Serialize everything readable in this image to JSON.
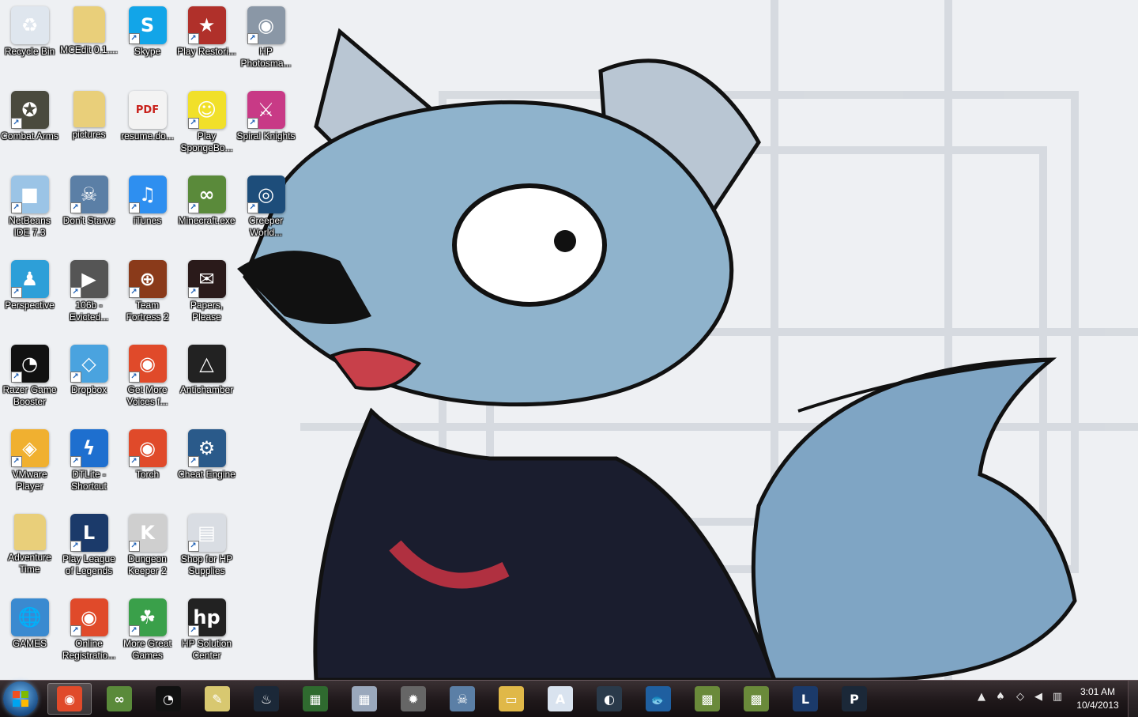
{
  "desktop": {
    "icons": [
      {
        "label": "Recycle Bin",
        "icon": "recycle-bin-icon",
        "bg": "#dfe6ee",
        "glyph": "♻",
        "shortcut": false
      },
      {
        "label": "MCEdit 0.1....",
        "icon": "folder-icon",
        "bg": "#e9cf7a",
        "glyph": "",
        "shortcut": false
      },
      {
        "label": "Skype",
        "icon": "skype-icon",
        "bg": "#12a5e8",
        "glyph": "S",
        "shortcut": true
      },
      {
        "label": "Play Restori...",
        "icon": "game-icon",
        "bg": "#b0302a",
        "glyph": "★",
        "shortcut": true
      },
      {
        "label": "HP Photosma...",
        "icon": "camera-icon",
        "bg": "#8a97a6",
        "glyph": "◉",
        "shortcut": true
      },
      {
        "label": "Combat Arms",
        "icon": "soldier-icon",
        "bg": "#4a4a3e",
        "glyph": "✪",
        "shortcut": true
      },
      {
        "label": "pictures",
        "icon": "folder-icon",
        "bg": "#e9cf7a",
        "glyph": "",
        "shortcut": false
      },
      {
        "label": "resume.do...",
        "icon": "pdf-icon",
        "bg": "#f3f3f3",
        "glyph": "PDF",
        "shortcut": false
      },
      {
        "label": "Play SpongeBo...",
        "icon": "spongebob-icon",
        "bg": "#f1e02a",
        "glyph": "☺",
        "shortcut": true
      },
      {
        "label": "Spiral Knights",
        "icon": "spiral-knights-icon",
        "bg": "#c83a86",
        "glyph": "⚔",
        "shortcut": true
      },
      {
        "label": "NetBeans IDE 7.3",
        "icon": "netbeans-cube-icon",
        "bg": "#9bc4e6",
        "glyph": "■",
        "shortcut": true
      },
      {
        "label": "Don't Starve",
        "icon": "dont-starve-icon",
        "bg": "#5b7fa6",
        "glyph": "☠",
        "shortcut": true
      },
      {
        "label": "iTunes",
        "icon": "itunes-icon",
        "bg": "#2e8ff0",
        "glyph": "♫",
        "shortcut": true
      },
      {
        "label": "Minecraft.exe",
        "icon": "minecraft-icon",
        "bg": "#5a8a3a",
        "glyph": "∞",
        "shortcut": true
      },
      {
        "label": "Creeper World...",
        "icon": "creeper-world-icon",
        "bg": "#1d4d7a",
        "glyph": "◎",
        "shortcut": true
      },
      {
        "label": "Perspective",
        "icon": "perspective-icon",
        "bg": "#2d9fd8",
        "glyph": "♟",
        "shortcut": true
      },
      {
        "label": "106b - Evicted...",
        "icon": "video-icon",
        "bg": "#555",
        "glyph": "▶",
        "shortcut": true
      },
      {
        "label": "Team Fortress 2",
        "icon": "tf2-icon",
        "bg": "#8a3a1a",
        "glyph": "⊕",
        "shortcut": true
      },
      {
        "label": "Papers, Please",
        "icon": "papers-please-icon",
        "bg": "#2a1a1a",
        "glyph": "✉",
        "shortcut": true
      },
      {
        "label": "Razer Game Booster",
        "icon": "razer-icon",
        "bg": "#111",
        "glyph": "◔",
        "shortcut": true
      },
      {
        "label": "Dropbox",
        "icon": "dropbox-icon",
        "bg": "#4aa3df",
        "glyph": "◇",
        "shortcut": true
      },
      {
        "label": "Get More Voices f...",
        "icon": "chrome-icon",
        "bg": "#e04a2a",
        "glyph": "◉",
        "shortcut": true
      },
      {
        "label": "Antichamber",
        "icon": "antichamber-icon",
        "bg": "#222",
        "glyph": "△",
        "shortcut": false
      },
      {
        "label": "VMware Player",
        "icon": "vmware-icon",
        "bg": "#f0b030",
        "glyph": "◈",
        "shortcut": true
      },
      {
        "label": "DTLite - Shortcut",
        "icon": "daemon-tools-icon",
        "bg": "#1e6fcf",
        "glyph": "ϟ",
        "shortcut": true
      },
      {
        "label": "Torch",
        "icon": "torch-icon",
        "bg": "#e04a2a",
        "glyph": "◉",
        "shortcut": true
      },
      {
        "label": "Cheat Engine",
        "icon": "cheat-engine-icon",
        "bg": "#2a5a8a",
        "glyph": "⚙",
        "shortcut": true
      },
      {
        "label": "Adventure Time",
        "icon": "folder-icon",
        "bg": "#e9cf7a",
        "glyph": "",
        "shortcut": false
      },
      {
        "label": "Play League of Legends",
        "icon": "league-icon",
        "bg": "#1b3a6a",
        "glyph": "L",
        "shortcut": true
      },
      {
        "label": "Dungeon Keeper 2",
        "icon": "dungeon-keeper-icon",
        "bg": "#cfcfcf",
        "glyph": "K",
        "shortcut": true
      },
      {
        "label": "Shop for HP Supplies",
        "icon": "printer-icon",
        "bg": "#d9dde3",
        "glyph": "▤",
        "shortcut": true
      },
      {
        "label": "GAMES",
        "icon": "globe-icon",
        "bg": "#3a8ad0",
        "glyph": "🌐",
        "shortcut": false
      },
      {
        "label": "Online Registratio...",
        "icon": "chrome-icon",
        "bg": "#e04a2a",
        "glyph": "◉",
        "shortcut": true
      },
      {
        "label": "More Great Games",
        "icon": "frog-icon",
        "bg": "#3aa04a",
        "glyph": "☘",
        "shortcut": true
      },
      {
        "label": "HP Solution Center",
        "icon": "hp-icon",
        "bg": "#222",
        "glyph": "hp",
        "shortcut": true
      }
    ]
  },
  "taskbar": {
    "start_icon": "windows-start-orb-icon",
    "pinned": [
      {
        "name": "chrome-icon",
        "bg": "#e04a2a",
        "glyph": "◉",
        "active": true
      },
      {
        "name": "minecraft-icon",
        "bg": "#5a8a3a",
        "glyph": "∞",
        "active": false
      },
      {
        "name": "razer-icon",
        "bg": "#111",
        "glyph": "◔",
        "active": false
      },
      {
        "name": "folder-notes-icon",
        "bg": "#d8c870",
        "glyph": "✎",
        "active": false
      },
      {
        "name": "steam-icon",
        "bg": "#1b2838",
        "glyph": "♨",
        "active": false
      },
      {
        "name": "task-manager-icon",
        "bg": "#2f6a2f",
        "glyph": "▦",
        "active": false
      },
      {
        "name": "calculator-icon",
        "bg": "#9aa8bc",
        "glyph": "▦",
        "active": false
      },
      {
        "name": "gear-icon",
        "bg": "#666",
        "glyph": "✹",
        "active": false
      },
      {
        "name": "dont-starve-icon",
        "bg": "#5b7fa6",
        "glyph": "☠",
        "active": false
      },
      {
        "name": "file-explorer-icon",
        "bg": "#e0b848",
        "glyph": "▭",
        "active": false
      },
      {
        "name": "wordpad-icon",
        "bg": "#d9e3ef",
        "glyph": "A",
        "active": false
      },
      {
        "name": "steam-alt-icon",
        "bg": "#2a3a4a",
        "glyph": "◐",
        "active": false
      },
      {
        "name": "big-fish-icon",
        "bg": "#1f5fa0",
        "glyph": "🐟",
        "active": false
      },
      {
        "name": "minecraft-block-icon",
        "bg": "#6a8a3a",
        "glyph": "▩",
        "active": false
      },
      {
        "name": "minecraft-block-icon-2",
        "bg": "#6a8a3a",
        "glyph": "▩",
        "active": false
      },
      {
        "name": "league-icon",
        "bg": "#1b3a6a",
        "glyph": "L",
        "active": false
      },
      {
        "name": "p-app-icon",
        "bg": "#1b2838",
        "glyph": "P",
        "active": false
      }
    ],
    "tray": [
      {
        "name": "show-hidden-icons-icon",
        "glyph": "▲"
      },
      {
        "name": "mushroom-icon",
        "glyph": "♠"
      },
      {
        "name": "dropbox-tray-icon",
        "glyph": "◇"
      },
      {
        "name": "volume-icon",
        "glyph": "◀"
      },
      {
        "name": "network-icon",
        "glyph": "▥"
      }
    ],
    "clock": {
      "time": "3:01 AM",
      "date": "10/4/2013"
    }
  }
}
